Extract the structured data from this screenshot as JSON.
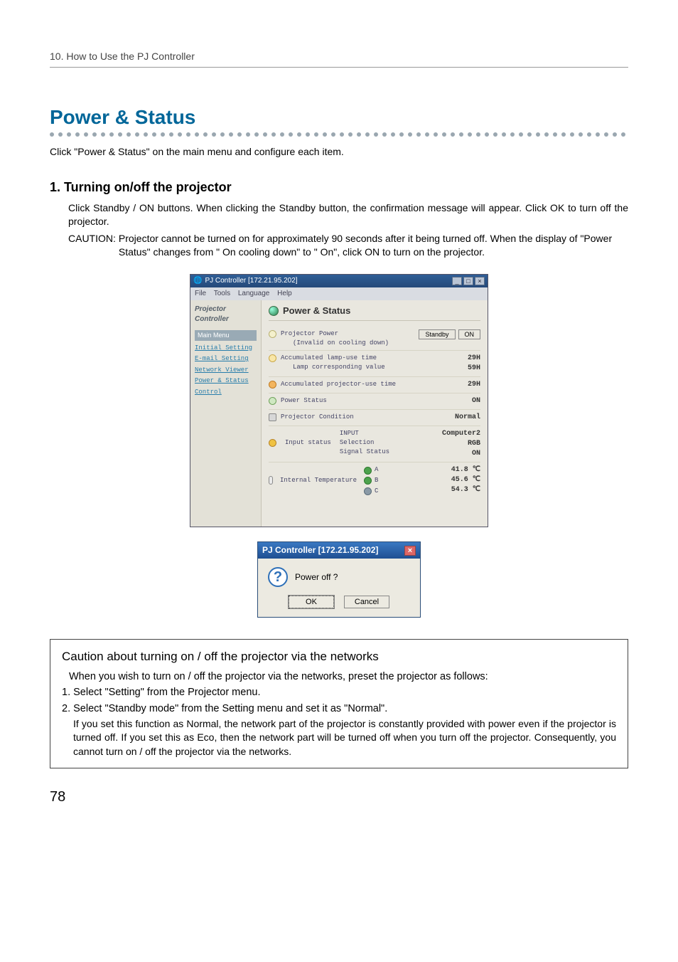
{
  "page_number": "78",
  "breadcrumb": "10. How to Use the PJ Controller",
  "title": "Power & Status",
  "intro": "Click \"Power & Status\" on the main menu and configure each item.",
  "sub1": {
    "heading": "1. Turning on/off the projector",
    "para": "Click Standby / ON buttons.  When clicking the Standby button, the confirmation message will appear.  Click OK to turn off the projector.",
    "caution_label": "CAUTION: ",
    "caution_text": "Projector cannot be turned on for approximately 90 seconds after it being turned off.  When the display of \"Power Status\" changes from \" On cooling down\" to \" On\", click ON to turn on the projector."
  },
  "window": {
    "title": "PJ Controller [172.21.95.202]",
    "menubar": {
      "file": "File",
      "tools": "Tools",
      "language": "Language",
      "help": "Help"
    },
    "min": "_",
    "max": "□",
    "close": "×",
    "sidebar": {
      "logo": "Projector Controller",
      "main_menu_label": "Main Menu",
      "items": [
        "Initial Setting",
        "E-mail Setting",
        "Network Viewer",
        "Power & Status",
        "Control"
      ]
    },
    "pane": {
      "title": "Power & Status",
      "rows": {
        "power": {
          "label": "Projector Power",
          "note": "(Invalid on cooling down)",
          "standby_btn": "Standby",
          "on_btn": "ON"
        },
        "lamp": {
          "l1": "Accumulated lamp-use time",
          "l2": "Lamp corresponding value",
          "v1": "29H",
          "v2": "59H"
        },
        "proj_use": {
          "label": "Accumulated projector-use time",
          "value": "29H"
        },
        "pstatus": {
          "label": "Power Status",
          "value": "ON"
        },
        "pcond": {
          "label": "Projector Condition",
          "value": "Normal"
        },
        "input": {
          "label": "Input status",
          "sub_input": "INPUT",
          "sub_sel": "Selection",
          "sub_sig": "Signal Status",
          "v_input": "Computer2",
          "v_sel": "RGB",
          "v_sig": "ON"
        },
        "temp": {
          "label": "Internal Temperature",
          "a_label": "A",
          "a_val": "41.8 ℃",
          "b_label": "B",
          "b_val": "45.6 ℃",
          "c_label": "C",
          "c_val": "54.3 ℃"
        }
      }
    }
  },
  "dialog": {
    "title": "PJ Controller [172.21.95.202]",
    "question_glyph": "?",
    "close_glyph": "×",
    "message": "Power off ?",
    "ok": "OK",
    "cancel": "Cancel"
  },
  "caution_box": {
    "heading": "Caution about turning on / off the projector via the networks",
    "lead": "When you wish to turn on / off the projector via the networks, preset the projector as follows:",
    "i1": "1. Select \"Setting\" from the Projector menu.",
    "i2": "2. Select \"Standby mode\" from the Setting menu and set it as \"Normal\".",
    "cont": "If you set this function as Normal, the network part of the projector is constantly provided with power even if the projector is turned off.  If you set this as Eco, then the network part will be turned off when you turn off the projector.  Consequently, you cannot turn on / off the projector via the networks."
  }
}
